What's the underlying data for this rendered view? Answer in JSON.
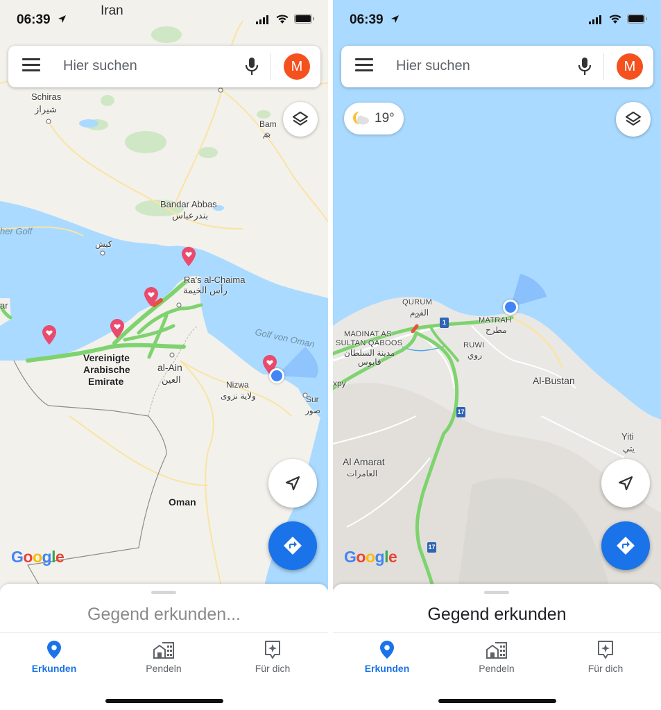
{
  "status": {
    "time": "06:39"
  },
  "search": {
    "placeholder": "Hier suchen",
    "avatar_letter": "M"
  },
  "left_map": {
    "labels": {
      "iran": "Iran",
      "shiraz": "Schiras",
      "shiraz_ar": "شيراز",
      "bam": "Bam",
      "bam_ar": "بم",
      "bandar_abbas": "Bandar Abbas",
      "bandar_abbas_ar": "بندرعباس",
      "persian_gulf": "her Golf",
      "kish": "كيش",
      "ras": "Ra's al-Chaima",
      "ras_ar": "رأس الخيمة",
      "gulf_oman": "Golf von Oman",
      "uae_line1": "Vereinigte",
      "uae_line2": "Arabische",
      "uae_line3": "Emirate",
      "al_ain": "al-Ain",
      "al_ain_ar": "العين",
      "nizwa": "Nizwa",
      "nizwa_ar": "ولاية نزوى",
      "sur": "Sur",
      "sur_ar": "صور",
      "oman": "Oman",
      "ar_edge": "ar"
    },
    "sheet_title": "Gegend erkunden..."
  },
  "right_map": {
    "weather": {
      "temp": "19°",
      "icon": "partly-cloudy-night"
    },
    "labels": {
      "qurum": "QURUM",
      "qurum_ar": "القرم",
      "matrah": "MATRAH",
      "matrah_ar": "مطرح",
      "madinat_1": "MADINAT AS",
      "madinat_2": "SULTAN QABOOS",
      "madinat_ar1": "مدينة السلطان",
      "madinat_ar2": "قابوس",
      "ruwi": "RUWI",
      "ruwi_ar": "روي",
      "al_bustan": "Al-Bustan",
      "yiti": "Yiti",
      "yiti_ar": "يتي",
      "al_amarat": "Al Amarat",
      "al_amarat_ar": "العامرات",
      "expy": "xpy",
      "route_1": "1",
      "route_17a": "17",
      "route_17b": "17"
    },
    "sheet_title": "Gegend erkunden"
  },
  "tabs": [
    {
      "label": "Erkunden",
      "icon": "place-pin-icon",
      "active": true
    },
    {
      "label": "Pendeln",
      "icon": "commute-buildings-icon",
      "active": false
    },
    {
      "label": "Für dich",
      "icon": "for-you-sparkle-icon",
      "active": false
    }
  ],
  "brand": {
    "g1": "G",
    "o1": "o",
    "o2": "o",
    "g2": "g",
    "l": "l",
    "e": "e"
  },
  "colors": {
    "accent": "#1a73e8",
    "avatar": "#f4511e",
    "sea": "#aadaff",
    "land": "#f1f3f4",
    "traffic": "#7ed36e",
    "pin": "#e94a6d"
  }
}
